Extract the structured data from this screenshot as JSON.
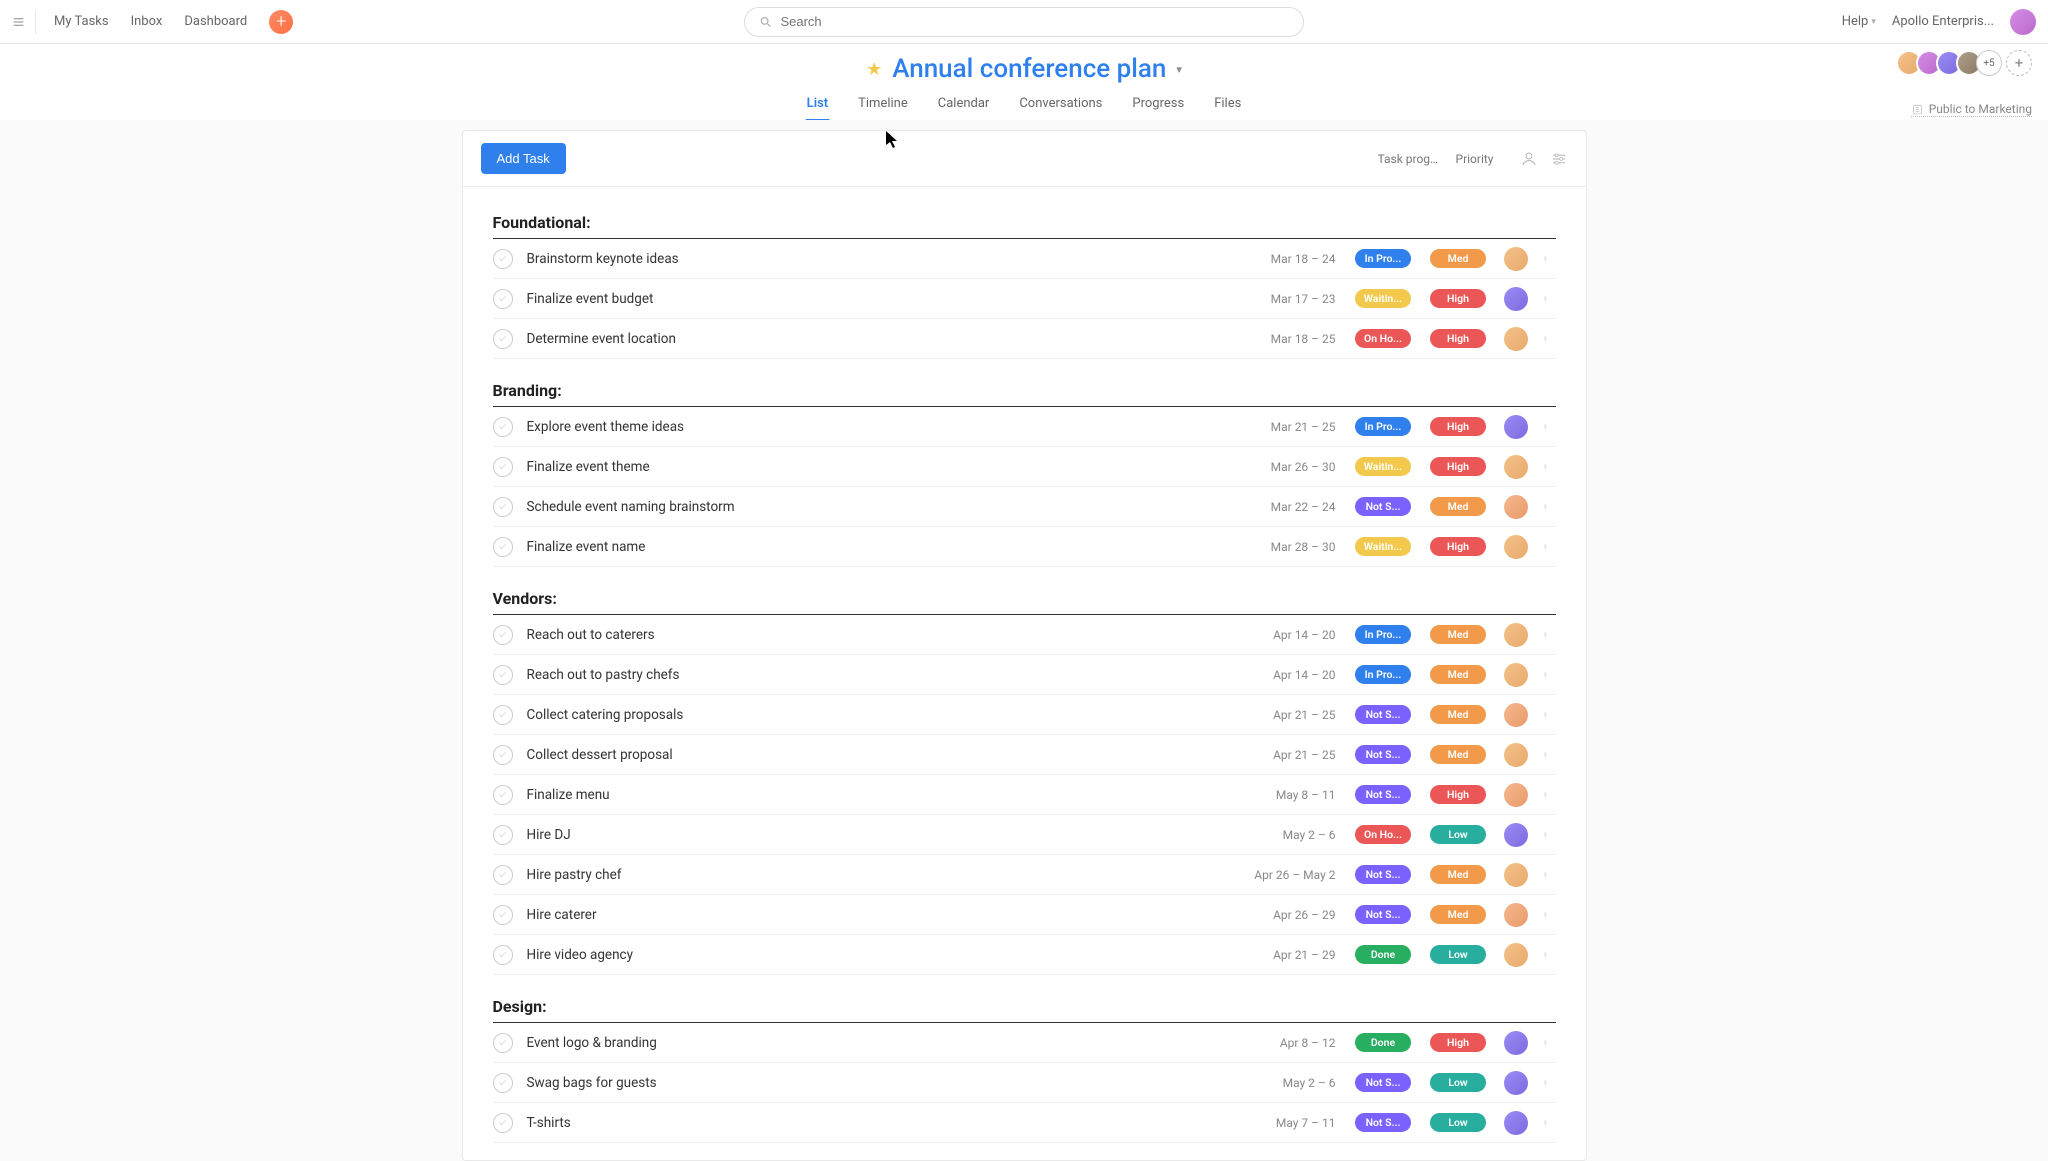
{
  "topnav": {
    "my_tasks": "My Tasks",
    "inbox": "Inbox",
    "dashboard": "Dashboard",
    "search_placeholder": "Search",
    "help": "Help",
    "org": "Apollo Enterpris..."
  },
  "project": {
    "title": "Annual conference plan",
    "tabs": [
      "List",
      "Timeline",
      "Calendar",
      "Conversations",
      "Progress",
      "Files"
    ],
    "active_tab": "List",
    "plus_count": "+5",
    "privacy": "Public to Marketing"
  },
  "toolbar": {
    "add_task": "Add Task",
    "field1": "Task progre...",
    "field2": "Priority"
  },
  "colors": {
    "progress": {
      "In Pro...": "#2f80ed",
      "Waitin...": "#f2c94c",
      "On Ho...": "#eb5757",
      "Not S...": "#7b61ff",
      "Done": "#27ae60"
    },
    "priority": {
      "High": "#eb5757",
      "Med": "#f2994a",
      "Low": "#27ae9e"
    }
  },
  "avatars": [
    "av-a",
    "av-b",
    "av-c",
    "av-d",
    "av-e",
    "av-f"
  ],
  "sections": [
    {
      "title": "Foundational:",
      "tasks": [
        {
          "title": "Brainstorm keynote ideas",
          "dates": "Mar 18 – 24",
          "progress": "In Pro...",
          "priority": "Med",
          "avatar": "av-e"
        },
        {
          "title": "Finalize event budget",
          "dates": "Mar 17 – 23",
          "progress": "Waitin...",
          "priority": "High",
          "avatar": "av-b"
        },
        {
          "title": "Determine event location",
          "dates": "Mar 18 – 25",
          "progress": "On Ho...",
          "priority": "High",
          "avatar": "av-e"
        }
      ]
    },
    {
      "title": "Branding:",
      "tasks": [
        {
          "title": "Explore event theme ideas",
          "dates": "Mar 21 – 25",
          "progress": "In Pro...",
          "priority": "High",
          "avatar": "av-b"
        },
        {
          "title": "Finalize event theme",
          "dates": "Mar 26 – 30",
          "progress": "Waitin...",
          "priority": "High",
          "avatar": "av-e"
        },
        {
          "title": "Schedule event naming brainstorm",
          "dates": "Mar 22 – 24",
          "progress": "Not S...",
          "priority": "Med",
          "avatar": "av-a"
        },
        {
          "title": "Finalize event name",
          "dates": "Mar 28 – 30",
          "progress": "Waitin...",
          "priority": "High",
          "avatar": "av-e"
        }
      ]
    },
    {
      "title": "Vendors:",
      "tasks": [
        {
          "title": "Reach out to caterers",
          "dates": "Apr 14 – 20",
          "progress": "In Pro...",
          "priority": "Med",
          "avatar": "av-e"
        },
        {
          "title": "Reach out to pastry chefs",
          "dates": "Apr 14 – 20",
          "progress": "In Pro...",
          "priority": "Med",
          "avatar": "av-e"
        },
        {
          "title": "Collect catering proposals",
          "dates": "Apr 21 – 25",
          "progress": "Not S...",
          "priority": "Med",
          "avatar": "av-a"
        },
        {
          "title": "Collect dessert proposal",
          "dates": "Apr 21 – 25",
          "progress": "Not S...",
          "priority": "Med",
          "avatar": "av-e"
        },
        {
          "title": "Finalize menu",
          "dates": "May 8 – 11",
          "progress": "Not S...",
          "priority": "High",
          "avatar": "av-a"
        },
        {
          "title": "Hire DJ",
          "dates": "May 2 – 6",
          "progress": "On Ho...",
          "priority": "Low",
          "avatar": "av-b"
        },
        {
          "title": "Hire pastry chef",
          "dates": "Apr 26 – May 2",
          "progress": "Not S...",
          "priority": "Med",
          "avatar": "av-e"
        },
        {
          "title": "Hire caterer",
          "dates": "Apr 26 – 29",
          "progress": "Not S...",
          "priority": "Med",
          "avatar": "av-a"
        },
        {
          "title": "Hire video agency",
          "dates": "Apr 21 – 29",
          "progress": "Done",
          "priority": "Low",
          "avatar": "av-e"
        }
      ]
    },
    {
      "title": "Design:",
      "tasks": [
        {
          "title": "Event logo & branding",
          "dates": "Apr 8 – 12",
          "progress": "Done",
          "priority": "High",
          "avatar": "av-b"
        },
        {
          "title": "Swag bags for guests",
          "dates": "May 2 – 6",
          "progress": "Not S...",
          "priority": "Low",
          "avatar": "av-b"
        },
        {
          "title": "T-shirts",
          "dates": "May 7 – 11",
          "progress": "Not S...",
          "priority": "Low",
          "avatar": "av-b"
        }
      ]
    }
  ]
}
